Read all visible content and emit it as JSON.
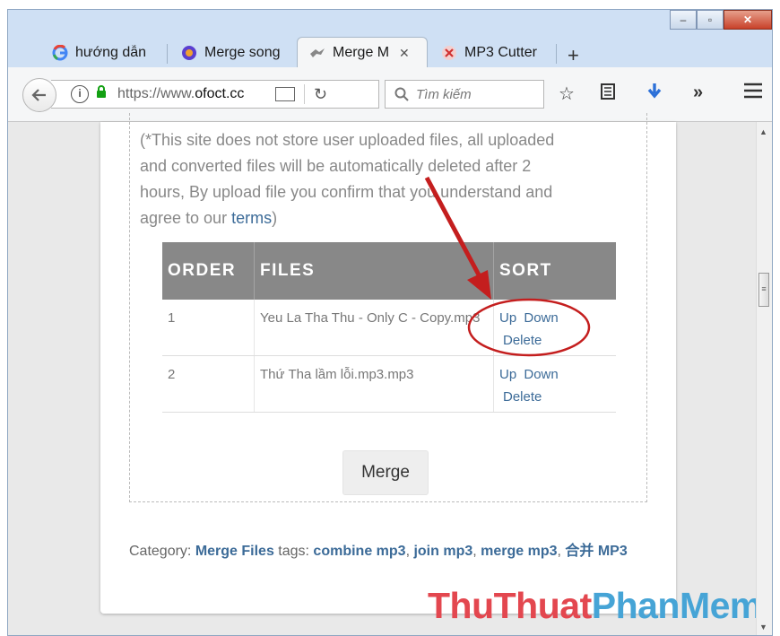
{
  "window": {
    "controls": {
      "minimize": "‒",
      "maximize": "▫",
      "close": "✕"
    }
  },
  "tabs": [
    {
      "label": "hướng dẫn",
      "icon": "google-icon"
    },
    {
      "label": "Merge song",
      "icon": "purple-circle-icon"
    },
    {
      "label": "Merge M",
      "icon": "bird-icon",
      "active": true,
      "close": "✕"
    },
    {
      "label": "MP3 Cutter",
      "icon": "scissors-icon"
    }
  ],
  "new_tab": "+",
  "nav": {
    "url_prefix": "https://www.",
    "url_domain": "ofoct.cc",
    "search_placeholder": "Tìm kiếm",
    "overflow": "»"
  },
  "page": {
    "notice_part1": "(*This site does not store user uploaded files, all uploaded and converted files will be automatically deleted after 2 hours, By upload file you confirm that you understand and agree to our ",
    "notice_link": "terms",
    "notice_part2": ")",
    "table": {
      "headers": [
        "ORDER",
        "FILES",
        "SORT"
      ],
      "rows": [
        {
          "order": "1",
          "file": "Yeu La Tha Thu - Only C - Copy.mp3",
          "up": "Up",
          "down": "Down",
          "delete": "Delete"
        },
        {
          "order": "2",
          "file": "Thứ Tha lầm lỗi.mp3.mp3",
          "up": "Up",
          "down": "Down",
          "delete": "Delete"
        }
      ]
    },
    "merge_button": "Merge",
    "category_label": "Category: ",
    "category_link": "Merge Files",
    "tags_label": " tags: ",
    "tags": [
      "combine mp3",
      "join mp3",
      "merge mp3",
      "合并 MP3"
    ]
  },
  "watermark": {
    "part1": "ThuThuat",
    "part2": "PhanMem.vn"
  },
  "colors": {
    "link": "#3c6b98",
    "header_bg": "#888888",
    "annotation": "#c41e1e"
  }
}
